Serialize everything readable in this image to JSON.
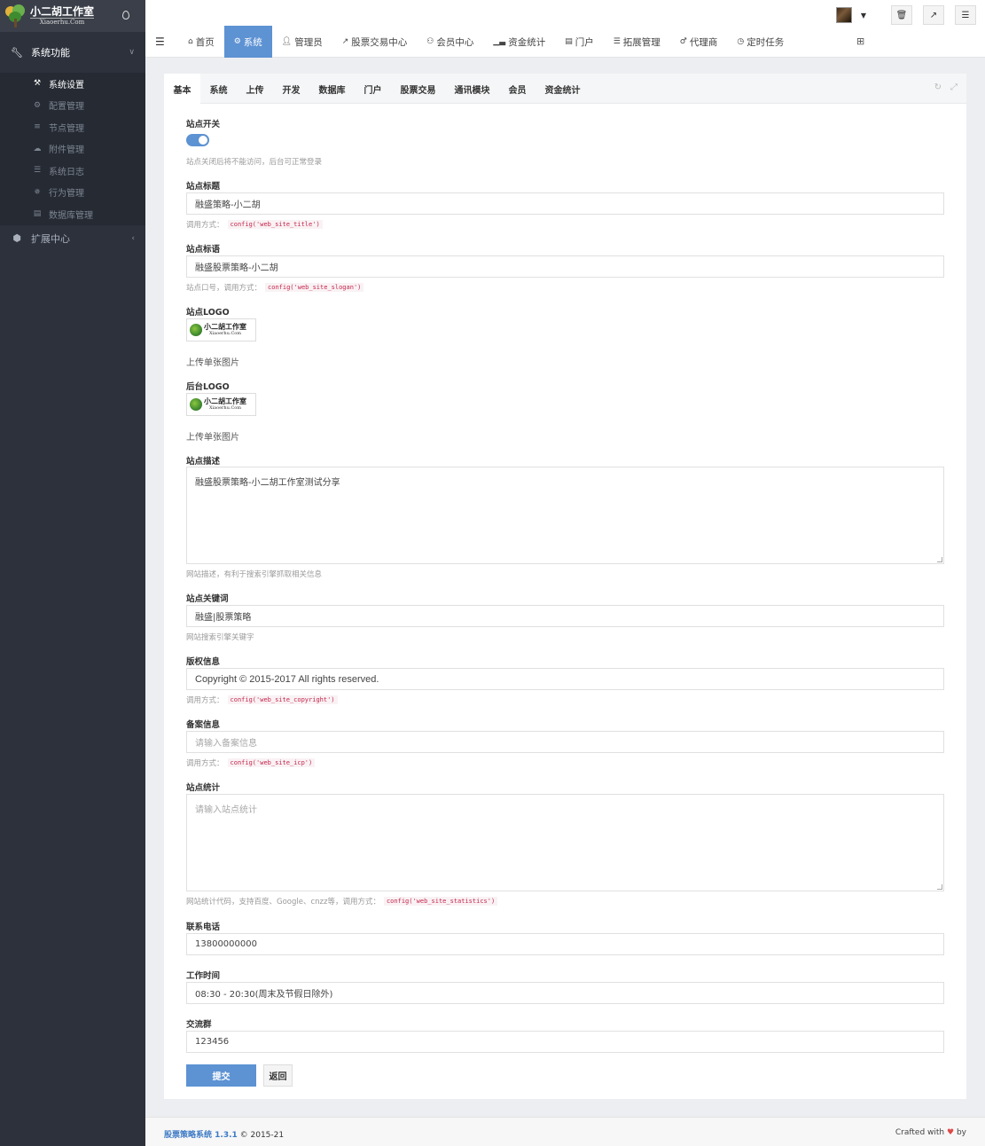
{
  "sidebar": {
    "logo": {
      "title": "小二胡工作室",
      "subtitle": "Xiaoerhu.Com"
    },
    "group_main": {
      "label": "系统功能",
      "icon": "wrench-icon"
    },
    "items": [
      {
        "label": "系统设置",
        "icon": "wrench-icon",
        "active": true
      },
      {
        "label": "配置管理",
        "icon": "gears-icon"
      },
      {
        "label": "节点管理",
        "icon": "bars-icon"
      },
      {
        "label": "附件管理",
        "icon": "cloud-upload-icon"
      },
      {
        "label": "系统日志",
        "icon": "file-text-icon"
      },
      {
        "label": "行为管理",
        "icon": "bug-icon"
      },
      {
        "label": "数据库管理",
        "icon": "database-icon"
      }
    ],
    "group_ext": {
      "label": "扩展中心",
      "icon": "cubes-icon"
    }
  },
  "topbar": {
    "tabs": [
      {
        "label": "首页",
        "icon": "home-icon"
      },
      {
        "label": "系统",
        "icon": "gear-icon",
        "active": true
      },
      {
        "label": "管理员",
        "icon": "user-icon"
      },
      {
        "label": "股票交易中心",
        "icon": "line-chart-icon"
      },
      {
        "label": "会员中心",
        "icon": "users-icon"
      },
      {
        "label": "资金统计",
        "icon": "bar-chart-icon"
      },
      {
        "label": "门户",
        "icon": "newspaper-icon"
      },
      {
        "label": "拓展管理",
        "icon": "list-icon"
      },
      {
        "label": "代理商",
        "icon": "male-icon"
      },
      {
        "label": "定时任务",
        "icon": "clock-icon"
      }
    ]
  },
  "card": {
    "tabs": [
      "基本",
      "系统",
      "上传",
      "开发",
      "数据库",
      "门户",
      "股票交易",
      "通讯模块",
      "会员",
      "资金统计"
    ],
    "active_tab": "基本"
  },
  "form": {
    "site_switch": {
      "label": "站点开关",
      "on": true,
      "help": "站点关闭后将不能访问，后台可正常登录"
    },
    "site_title": {
      "label": "站点标题",
      "value": "融盛策略-小二胡",
      "help": "调用方式：",
      "code": "config('web_site_title')"
    },
    "site_slogan": {
      "label": "站点标语",
      "value": "融盛股票策略-小二胡",
      "help": "站点口号，调用方式：",
      "code": "config('web_site_slogan')"
    },
    "site_logo": {
      "label": "站点LOGO",
      "thumb_title": "小二胡工作室",
      "thumb_sub": "Xiaoerhu.Com",
      "hint": "上传单张图片"
    },
    "admin_logo": {
      "label": "后台LOGO",
      "thumb_title": "小二胡工作室",
      "thumb_sub": "Xiaoerhu.Com",
      "hint": "上传单张图片"
    },
    "site_desc": {
      "label": "站点描述",
      "value": "融盛股票策略-小二胡工作室测试分享",
      "help": "网站描述，有利于搜索引擎抓取相关信息"
    },
    "site_keywords": {
      "label": "站点关键词",
      "value": "融盛|股票策略",
      "help": "网站搜索引擎关键字"
    },
    "copyright": {
      "label": "版权信息",
      "value": "Copyright © 2015-2017 All rights reserved.",
      "help": "调用方式：",
      "code": "config('web_site_copyright')"
    },
    "icp": {
      "label": "备案信息",
      "placeholder": "请输入备案信息",
      "help": "调用方式：",
      "code": "config('web_site_icp')"
    },
    "statistics": {
      "label": "站点统计",
      "placeholder": "请输入站点统计",
      "help": "网站统计代码，支持百度、Google、cnzz等，调用方式：",
      "code": "config('web_site_statistics')"
    },
    "phone": {
      "label": "联系电话",
      "value": "13800000000"
    },
    "work_time": {
      "label": "工作时间",
      "value": "08:30 - 20:30(周末及节假日除外)"
    },
    "group": {
      "label": "交流群",
      "value": "123456"
    },
    "submit_label": "提交",
    "back_label": "返回"
  },
  "footer": {
    "brand": "股票策略系统 1.3.1",
    "years": "© 2015-21",
    "crafted": "Crafted with",
    "by": "by"
  },
  "colors": {
    "accent": "#5d92d3",
    "sidebar_bg": "#2c313c",
    "code_red": "#c7254e"
  }
}
